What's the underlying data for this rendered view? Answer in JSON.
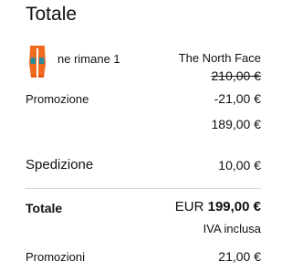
{
  "summary": {
    "title": "Totale"
  },
  "item": {
    "image_icon": "orange-trousers-thumbnail",
    "quantity_note": "ne rimane 1",
    "brand": "The North Face",
    "original_price": "210,00 €",
    "promotion_label": "Promozione",
    "promotion_amount": "-21,00 €",
    "final_price": "189,00 €"
  },
  "shipping": {
    "label": "Spedizione",
    "amount": "10,00 €"
  },
  "total": {
    "label": "Totale",
    "currency": "EUR",
    "amount": "199,00 €",
    "vat_note": "IVA inclusa"
  },
  "promotions": {
    "label": "Promozioni",
    "amount": "21,00 €"
  },
  "colors": {
    "text": "#111111",
    "divider": "#d7d7d7",
    "product_orange": "#f06a1f",
    "product_teal": "#2a8c9a"
  }
}
